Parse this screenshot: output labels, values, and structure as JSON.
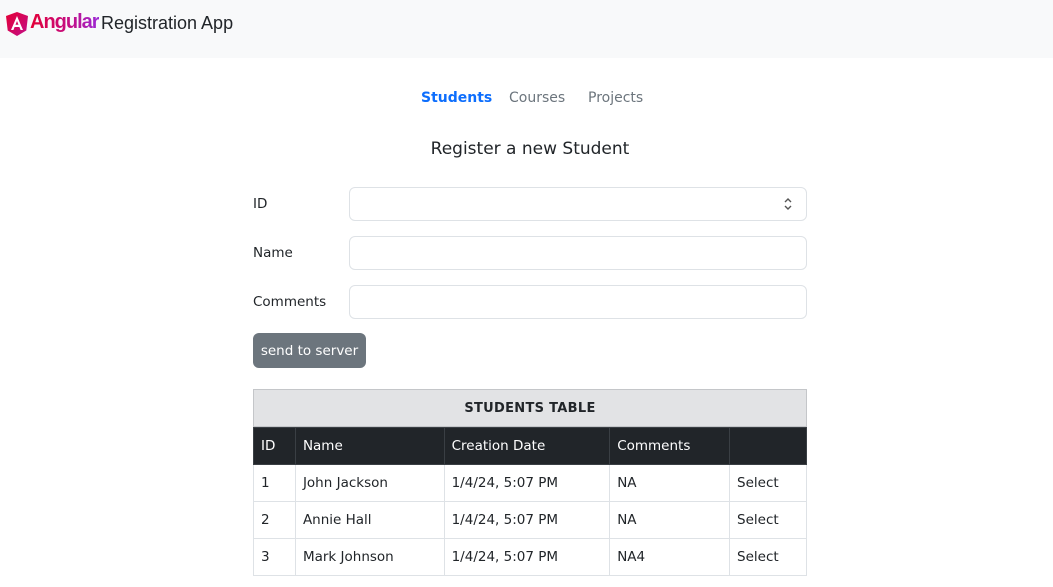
{
  "navbar": {
    "brand": "Angular",
    "app_title": "Registration App",
    "logo_icon": "angular-logo-icon"
  },
  "tabs": [
    {
      "label": "Students",
      "active": true
    },
    {
      "label": "Courses",
      "active": false
    },
    {
      "label": "Projects",
      "active": false
    }
  ],
  "form": {
    "title": "Register a new Student",
    "fields": {
      "id": {
        "label": "ID",
        "value": "",
        "placeholder": "",
        "type": "number"
      },
      "name": {
        "label": "Name",
        "value": "",
        "placeholder": ""
      },
      "comments": {
        "label": "Comments",
        "value": "",
        "placeholder": ""
      }
    },
    "submit_label": "send to server"
  },
  "table": {
    "caption": "STUDENTS TABLE",
    "headers": [
      "ID",
      "Name",
      "Creation Date",
      "Comments",
      ""
    ],
    "rows": [
      {
        "id": "1",
        "name": "John Jackson",
        "date": "1/4/24, 5:07 PM",
        "comments": "NA",
        "action": "Select"
      },
      {
        "id": "2",
        "name": "Annie Hall",
        "date": "1/4/24, 5:07 PM",
        "comments": "NA",
        "action": "Select"
      },
      {
        "id": "3",
        "name": "Mark Johnson",
        "date": "1/4/24, 5:07 PM",
        "comments": "NA4",
        "action": "Select"
      }
    ]
  },
  "colors": {
    "navbar_bg": "#f8f9fa",
    "active_tab": "#0d6efd",
    "button_bg": "#6c757d",
    "table_head_bg": "#212529",
    "caption_bg": "#e2e3e5"
  }
}
